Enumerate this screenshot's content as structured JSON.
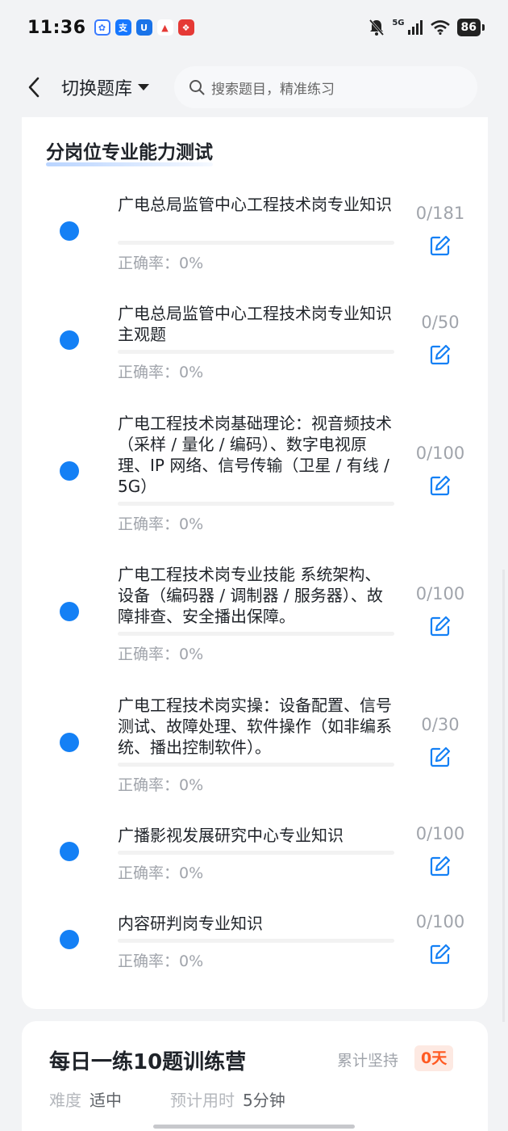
{
  "status_bar": {
    "time": "11:36",
    "network": "5G",
    "battery": "86"
  },
  "nav": {
    "switch_label": "切换题库",
    "search_placeholder": "搜索题目，精准练习"
  },
  "section": {
    "title": "分岗位专业能力测试",
    "items": [
      {
        "title": "广电总局监管中心工程技术岗专业知识",
        "count": "0/181",
        "accuracy": "正确率：0%",
        "progress": 0
      },
      {
        "title": "广电总局监管中心工程技术岗专业知识主观题",
        "count": "0/50",
        "accuracy": "正确率：0%",
        "progress": 0
      },
      {
        "title": "广电工程技术岗基础理论：视音频技术（采样 / 量化 / 编码）、数字电视原理、IP 网络、信号传输（卫星 / 有线 / 5G）",
        "count": "0/100",
        "accuracy": "正确率：0%",
        "progress": 0
      },
      {
        "title": "广电工程技术岗专业技能 系统架构、设备（编码器 / 调制器 / 服务器）、故障排查、安全播出保障。",
        "count": "0/100",
        "accuracy": "正确率：0%",
        "progress": 0
      },
      {
        "title": "广电工程技术岗实操：设备配置、信号测试、故障处理、软件操作（如非编系统、播出控制软件）。",
        "count": "0/30",
        "accuracy": "正确率：0%",
        "progress": 0
      },
      {
        "title": "广播影视发展研究中心专业知识",
        "count": "0/100",
        "accuracy": "正确率：0%",
        "progress": 0
      },
      {
        "title": "内容研判岗专业知识",
        "count": "0/100",
        "accuracy": "正确率：0%",
        "progress": 0
      }
    ]
  },
  "daily": {
    "title": "每日一练10题训练营",
    "streak_label": "累计坚持",
    "streak_value": "0天",
    "difficulty_label": "难度",
    "difficulty_value": "适中",
    "time_label": "预计用时",
    "time_value": "5分钟"
  },
  "colors": {
    "accent": "#1480f5",
    "streak": "#ff5a22"
  }
}
